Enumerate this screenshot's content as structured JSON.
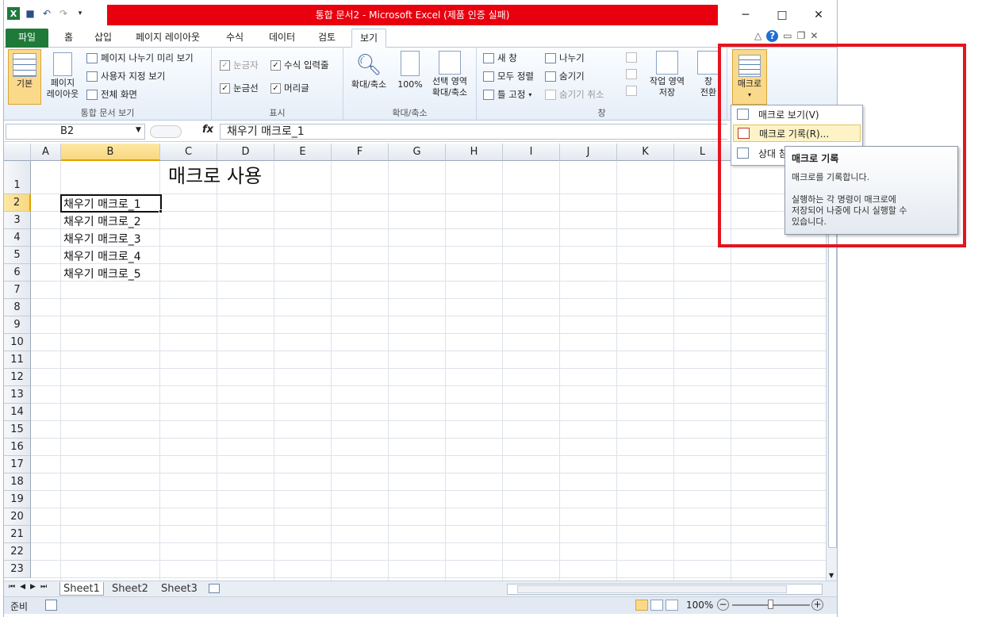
{
  "window": {
    "title": "통합 문서2 - Microsoft Excel (제품 인증 실패)",
    "minimize": "─",
    "maximize": "□",
    "close": "✕"
  },
  "tabs": {
    "file": "파일",
    "items": [
      "홈",
      "삽입",
      "페이지 레이아웃",
      "수식",
      "데이터",
      "검토",
      "보기"
    ],
    "active": "보기"
  },
  "ribbon": {
    "workbook_views": {
      "normal": "기본",
      "page_layout_1": "페이지",
      "page_layout_2": "레이아웃",
      "page_break_preview": "페이지 나누기 미리 보기",
      "custom_views": "사용자 지정 보기",
      "full_screen": "전체 화면",
      "label": "통합 문서 보기"
    },
    "show": {
      "ruler": "눈금자",
      "formula_bar": "수식 입력줄",
      "gridlines": "눈금선",
      "headings": "머리글",
      "label": "표시"
    },
    "zoom": {
      "zoom": "확대/축소",
      "hundred": "100%",
      "zoom_sel_1": "선택 영역",
      "zoom_sel_2": "확대/축소",
      "label": "확대/축소"
    },
    "window": {
      "new_window": "새 창",
      "arrange_all": "모두 정렬",
      "freeze_panes": "틀 고정",
      "split": "나누기",
      "hide": "숨기기",
      "unhide": "숨기기 취소",
      "save_ws_1": "작업 영역",
      "save_ws_2": "저장",
      "switch_1": "창",
      "switch_2": "전환",
      "label": "창"
    },
    "macros": {
      "label": "매크로"
    }
  },
  "formula_bar": {
    "name_box": "B2",
    "fx": "fx",
    "content": "채우기 매크로_1"
  },
  "grid": {
    "columns": [
      "A",
      "B",
      "C",
      "D",
      "E",
      "F",
      "G",
      "H",
      "I",
      "J",
      "K",
      "L"
    ],
    "rows": [
      "1",
      "2",
      "3",
      "4",
      "5",
      "6",
      "7",
      "8",
      "9",
      "10",
      "11",
      "12",
      "13",
      "14",
      "15",
      "16",
      "17",
      "18",
      "19",
      "20",
      "21",
      "22",
      "23"
    ],
    "cells": {
      "C1": "매크로 사용",
      "B2": "채우기 매크로_1",
      "B3": "채우기 매크로_2",
      "B4": "채우기 매크로_3",
      "B5": "채우기 매크로_4",
      "B6": "채우기 매크로_5"
    }
  },
  "sheets": [
    "Sheet1",
    "Sheet2",
    "Sheet3"
  ],
  "status": {
    "ready": "준비",
    "zoom": "100%"
  },
  "macro_menu": {
    "view": "매크로 보기(V)",
    "record": "매크로 기록(R)...",
    "relative": "상대 참"
  },
  "tooltip": {
    "title": "매크로 기록",
    "line1": "매크로를 기록합니다.",
    "line2": "실행하는 각 명령이 매크로에\n저장되어 나중에 다시 실행할 수\n있습니다."
  },
  "colors": {
    "accent": "#1f7a3a",
    "title_highlight": "#e8000f",
    "annotation": "#e5141f"
  }
}
